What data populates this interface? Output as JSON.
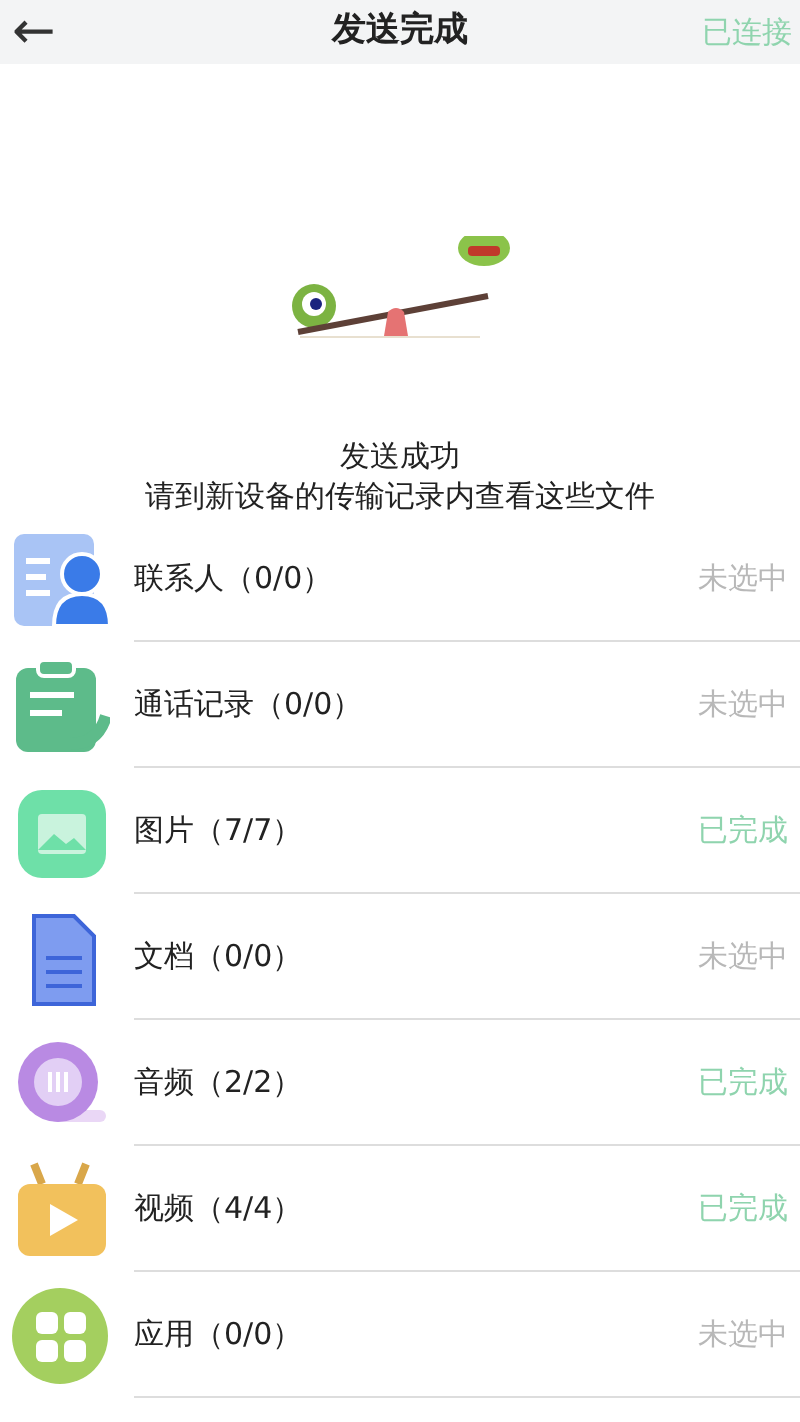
{
  "header": {
    "back": "←",
    "title": "发送完成",
    "status": "已连接"
  },
  "message": {
    "title": "发送成功",
    "subtitle": "请到新设备的传输记录内查看这些文件"
  },
  "items": [
    {
      "kind": "contacts",
      "label": "联系人（0/0）",
      "status": "未选中",
      "done": false
    },
    {
      "kind": "calls",
      "label": "通话记录（0/0）",
      "status": "未选中",
      "done": false
    },
    {
      "kind": "images",
      "label": "图片（7/7）",
      "status": "已完成",
      "done": true
    },
    {
      "kind": "docs",
      "label": "文档（0/0）",
      "status": "未选中",
      "done": false
    },
    {
      "kind": "audio",
      "label": "音频（2/2）",
      "status": "已完成",
      "done": true
    },
    {
      "kind": "video",
      "label": "视频（4/4）",
      "status": "已完成",
      "done": true
    },
    {
      "kind": "apps",
      "label": "应用（0/0）",
      "status": "未选中",
      "done": false
    }
  ]
}
